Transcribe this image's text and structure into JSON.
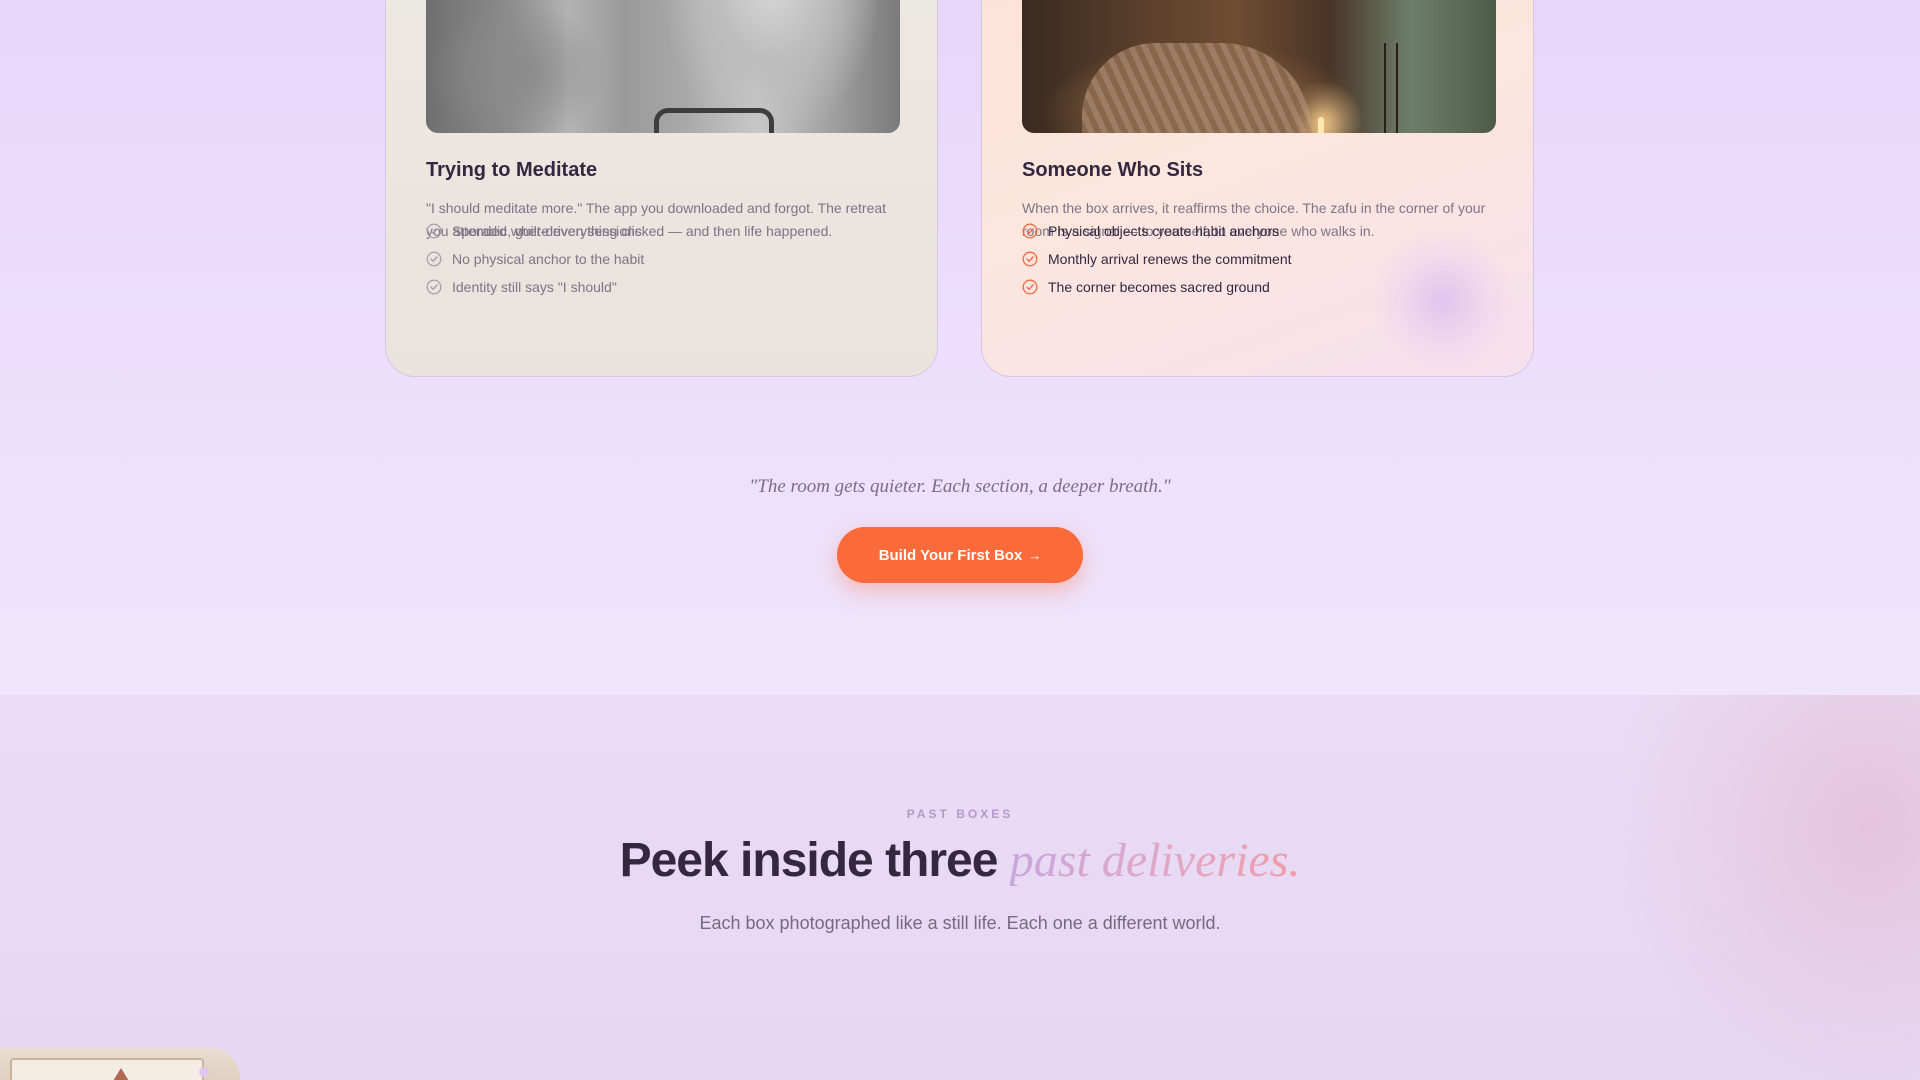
{
  "cards": [
    {
      "title": "Trying to Meditate",
      "body": "\"I should meditate more.\" The app you downloaded and forgot. The retreat you attended where everything clicked — and then life happened.",
      "items": [
        "Sporadic, guilt-driven sessions",
        "No physical anchor to the habit",
        "Identity still says \"I should\""
      ],
      "check_color": "#a39aa8"
    },
    {
      "title": "Someone Who Sits",
      "body": "When the box arrives, it reaffirms the choice. The zafu in the corner of your room is a signal — to yourself, to everyone who walks in.",
      "items": [
        "Physical objects create habit anchors",
        "Monthly arrival renews the commitment",
        "The corner becomes sacred ground"
      ],
      "check_color": "#f26b3f"
    }
  ],
  "quote": "\"The room gets quieter. Each section, a deeper breath.\"",
  "cta": {
    "label": "Build Your First Box",
    "arrow": "→"
  },
  "past_boxes": {
    "eyebrow": "PAST BOXES",
    "heading_main": "Peek inside three",
    "heading_accent": "past deliveries.",
    "subheading": "Each box photographed like a still life. Each one a different world."
  },
  "colors": {
    "accent": "#fb6a3b",
    "text_dark": "#33283f",
    "text_muted": "#7d7485",
    "background": "#ecdcfb"
  }
}
